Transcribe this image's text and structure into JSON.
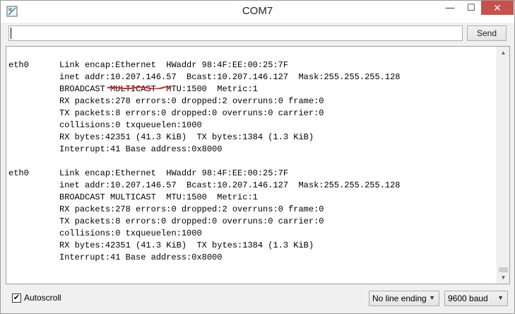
{
  "window": {
    "title": "COM7"
  },
  "titlebar": {
    "minimize": "—",
    "maximize": "☐",
    "close": "✕"
  },
  "input": {
    "value": ""
  },
  "send_button": {
    "label": "Send"
  },
  "console": {
    "lines": [
      "eth0      Link encap:Ethernet  HWaddr 98:4F:EE:00:25:7F",
      "          inet addr:10.207.146.57  Bcast:10.207.146.127  Mask:255.255.255.128",
      "          BROADCAST MULTICAST  MTU:1500  Metric:1",
      "          RX packets:278 errors:0 dropped:2 overruns:0 frame:0",
      "          TX packets:8 errors:0 dropped:0 overruns:0 carrier:0",
      "          collisions:0 txqueuelen:1000",
      "          RX bytes:42351 (41.3 KiB)  TX bytes:1384 (1.3 KiB)",
      "          Interrupt:41 Base address:0x8000",
      "",
      "eth0      Link encap:Ethernet  HWaddr 98:4F:EE:00:25:7F",
      "          inet addr:10.207.146.57  Bcast:10.207.146.127  Mask:255.255.255.128",
      "          BROADCAST MULTICAST  MTU:1500  Metric:1",
      "          RX packets:278 errors:0 dropped:2 overruns:0 frame:0",
      "          TX packets:8 errors:0 dropped:0 overruns:0 carrier:0",
      "          collisions:0 txqueuelen:1000",
      "          RX bytes:42351 (41.3 KiB)  TX bytes:1384 (1.3 KiB)",
      "          Interrupt:41 Base address:0x8000"
    ]
  },
  "footer": {
    "autoscroll_label": "Autoscroll",
    "autoscroll_checked": true,
    "autoscroll_mark": "✔",
    "line_ending": "No line ending",
    "baud": "9600 baud"
  },
  "colors": {
    "close_button": "#c7504b",
    "underline": "#e02020"
  }
}
